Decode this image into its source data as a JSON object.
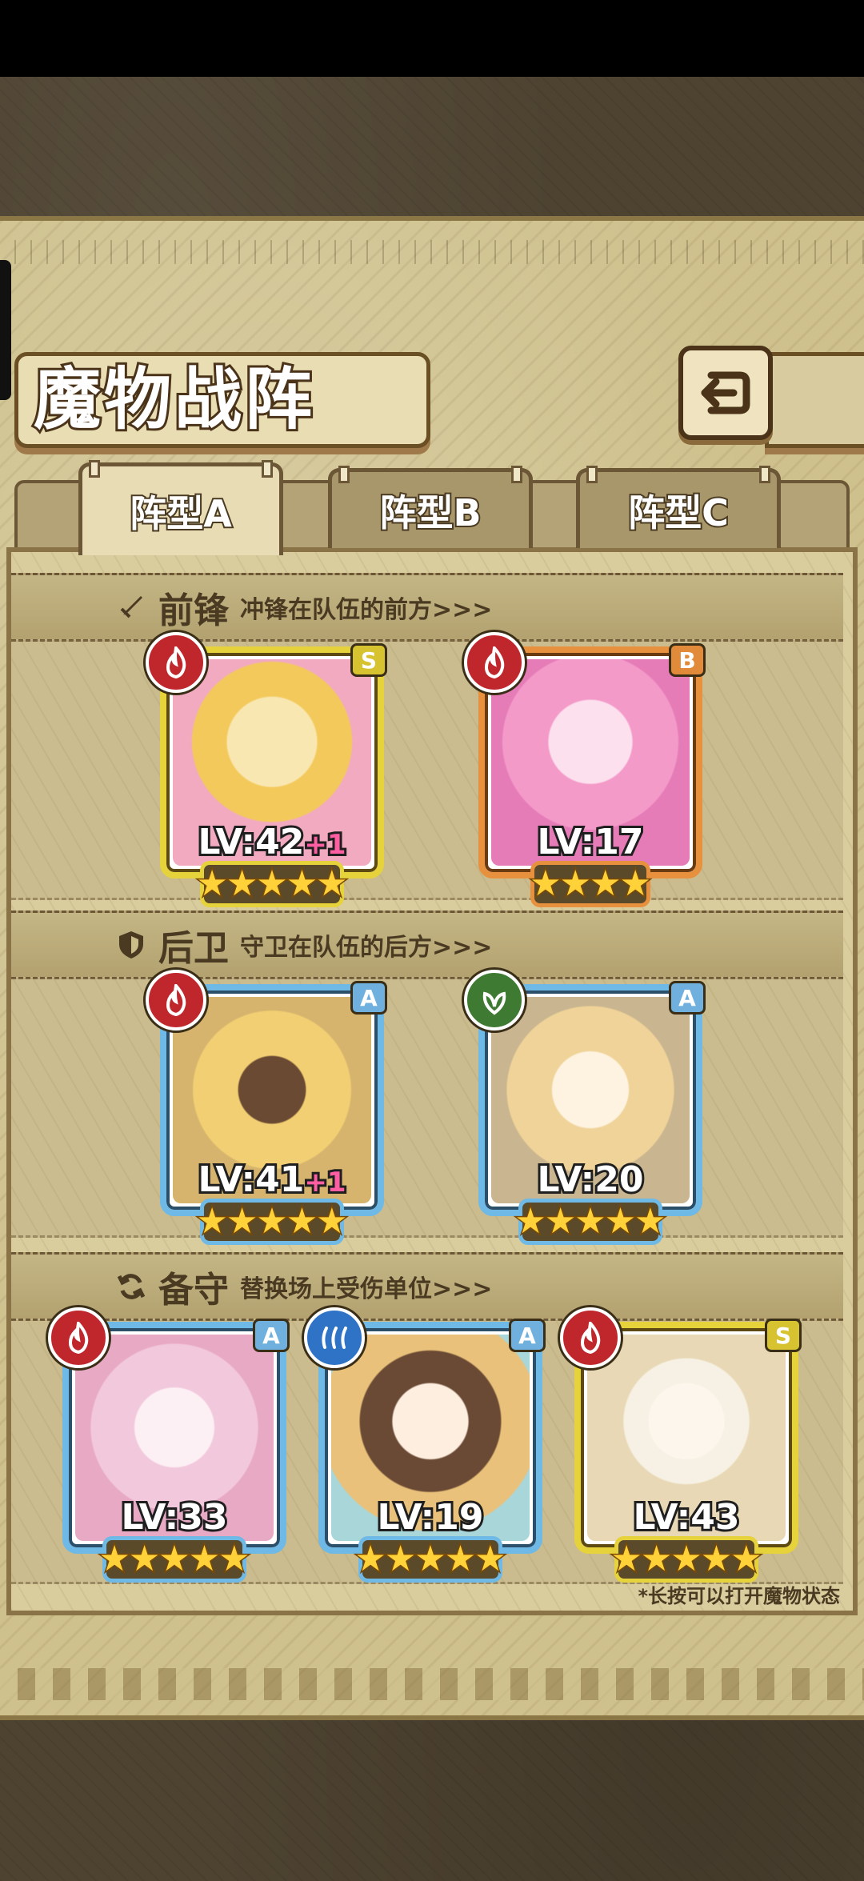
{
  "screen": {
    "title": "魔物战阵",
    "back_icon": "back-arrow-icon"
  },
  "tabs": [
    {
      "label": "阵型A",
      "active": true
    },
    {
      "label": "阵型B",
      "active": false
    },
    {
      "label": "阵型C",
      "active": false
    }
  ],
  "sections": {
    "front": {
      "icon": "sword-icon",
      "title": "前锋",
      "subtitle": "冲锋在队伍的前方>>>"
    },
    "rear": {
      "icon": "shield-icon",
      "title": "后卫",
      "subtitle": "守卫在队伍的后方>>>"
    },
    "reserve": {
      "icon": "refresh-icon",
      "title": "备守",
      "subtitle": "替换场上受伤单位>>>"
    }
  },
  "units": {
    "front": [
      {
        "rank": "S",
        "element": "fire",
        "level": "LV:42",
        "bonus": "+1",
        "stars": 5
      },
      {
        "rank": "B",
        "element": "fire",
        "level": "LV:17",
        "bonus": "",
        "stars": 4
      }
    ],
    "rear": [
      {
        "rank": "A",
        "element": "fire",
        "level": "LV:41",
        "bonus": "+1",
        "stars": 5
      },
      {
        "rank": "A",
        "element": "nature",
        "level": "LV:20",
        "bonus": "",
        "stars": 5
      }
    ],
    "reserve": [
      {
        "rank": "A",
        "element": "fire",
        "level": "LV:33",
        "bonus": "",
        "stars": 5
      },
      {
        "rank": "A",
        "element": "water",
        "level": "LV:19",
        "bonus": "",
        "stars": 5
      },
      {
        "rank": "S",
        "element": "fire",
        "level": "LV:43",
        "bonus": "",
        "stars": 5
      }
    ]
  },
  "hint": "*长按可以打开魔物状态",
  "colors": {
    "rank_s": "#e6d23a",
    "rank_a": "#6fb9e6",
    "rank_b": "#e7913e",
    "fire": "#c0272d",
    "nature": "#3e7a32",
    "water": "#2f73c6"
  }
}
